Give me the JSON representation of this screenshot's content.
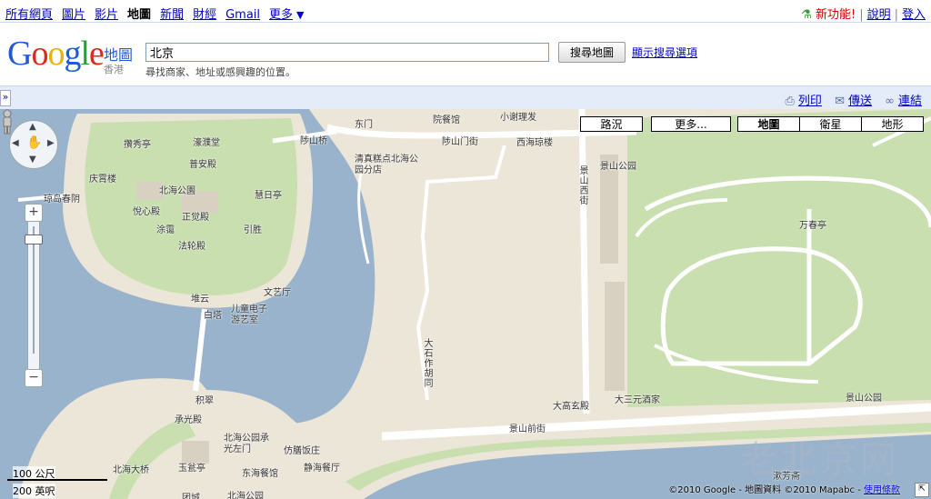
{
  "topnav": {
    "links": [
      "所有網頁",
      "圖片",
      "影片",
      "地圖",
      "新聞",
      "財經",
      "Gmail",
      "更多"
    ],
    "more_arrow": "▼",
    "new_features": "新功能!",
    "help": "說明",
    "sign_in": "登入"
  },
  "header": {
    "logo": "Google",
    "product": "地圖",
    "region": "香港",
    "search_value": "北京",
    "search_hint": "尋找商家、地址或感興趣的位置。",
    "search_button": "搜尋地圖",
    "options_link": "顯示搜尋選項"
  },
  "toolbar": {
    "toggle": "»",
    "print": "列印",
    "send": "傳送",
    "link": "連結"
  },
  "map": {
    "traffic_button": "路況",
    "more_button": "更多...",
    "map_types": [
      "地圖",
      "衛星",
      "地形"
    ],
    "selected_type": "地圖",
    "scale_metric": "100 公尺",
    "scale_imperial": "200 英呎",
    "copyright": "©2010 Google - 地圖資料 ©2010 Mapabc - ",
    "terms": "使用條款",
    "watermark": "老北京网",
    "labels": {
      "l1": "攢秀亭",
      "l2": "濠濮堂",
      "l3": "普安殿",
      "l4": "庆霄楼",
      "l5": "北海公園",
      "l6": "悅心殿",
      "l7": "正觉殿",
      "l8": "慧日亭",
      "l9": "琼岛春阴",
      "l10": "涂霭",
      "l11": "引胜",
      "l12": "法轮殿",
      "l13": "陟山桥",
      "l14": "东门",
      "l15": "院餐馆",
      "l16": "小谢理发",
      "l17": "陟山门街",
      "l18": "西海琼楼",
      "l19": "清真糕点北海公园分店",
      "l20": "景山公园",
      "l21": "景山西街",
      "l22": "万春亭",
      "l23": "堆云",
      "l24": "白塔",
      "l25": "文艺厅",
      "l26": "儿童电子游艺室",
      "l27": "大石作胡同",
      "l28": "积翠",
      "l29": "承光殿",
      "l30": "大高玄殿",
      "l31": "大三元酒家",
      "l32": "景山公园",
      "l33": "景山前街",
      "l34": "北海公园承光左门",
      "l35": "仿膳饭庄",
      "l36": "玉瓮亭",
      "l37": "北海大桥",
      "l38": "东海餐馆",
      "l39": "静海餐厅",
      "l40": "团城",
      "l41": "北海公园",
      "l42": "漱芳斋"
    }
  }
}
